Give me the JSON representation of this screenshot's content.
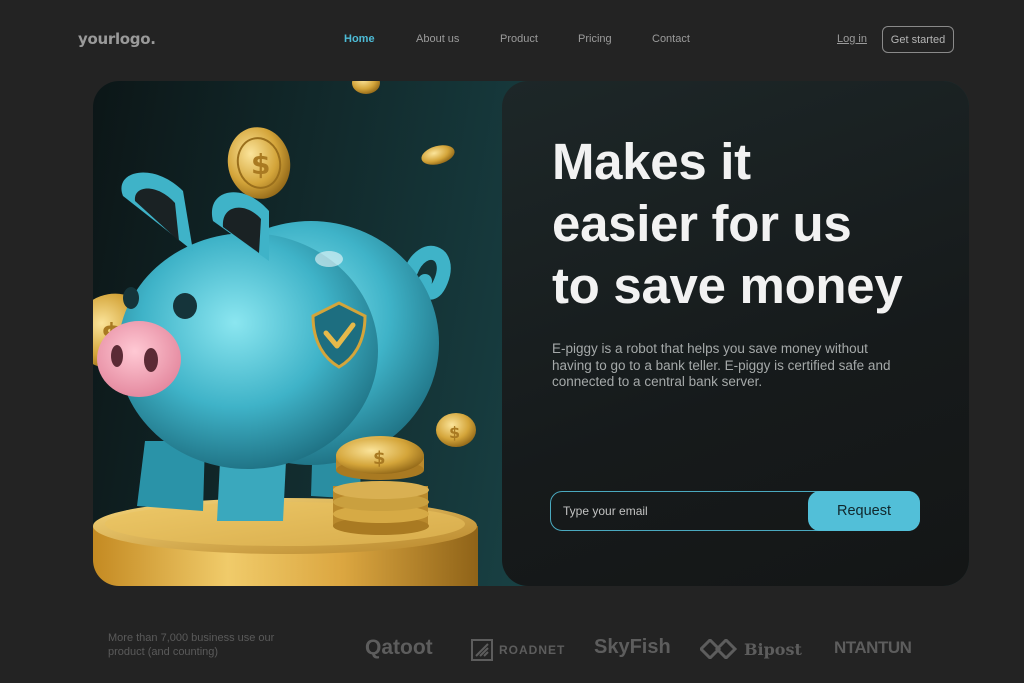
{
  "header": {
    "logo": "yourlogo.",
    "nav": [
      {
        "label": "Home",
        "active": true
      },
      {
        "label": "About us",
        "active": false
      },
      {
        "label": "Product",
        "active": false
      },
      {
        "label": "Pricing",
        "active": false
      },
      {
        "label": "Contact",
        "active": false
      }
    ],
    "login_label": "Log in",
    "cta_label": "Get started"
  },
  "hero": {
    "headline_lines": [
      "Makes it",
      "easier for us",
      "to save money"
    ],
    "description": "E-piggy is a robot that helps you save money without having to go to a bank teller. E-piggy is certified safe and connected to a central bank server.",
    "email_placeholder": "Type your email",
    "request_label": "Request",
    "illustration_icons": [
      "piggy-bank-icon",
      "coin-icon",
      "shield-check-icon"
    ]
  },
  "footer": {
    "trust_text": "More than 7,000 business use our product (and counting)",
    "brands": [
      "Qatoot",
      "ROADNET",
      "SkyFish",
      "Bipost",
      "NTANTUN"
    ]
  },
  "colors": {
    "accent": "#52bfd8",
    "background": "#232323",
    "panel": "#171b1c",
    "piggy": "#4ec3d6",
    "gold": "#d4a53a"
  }
}
